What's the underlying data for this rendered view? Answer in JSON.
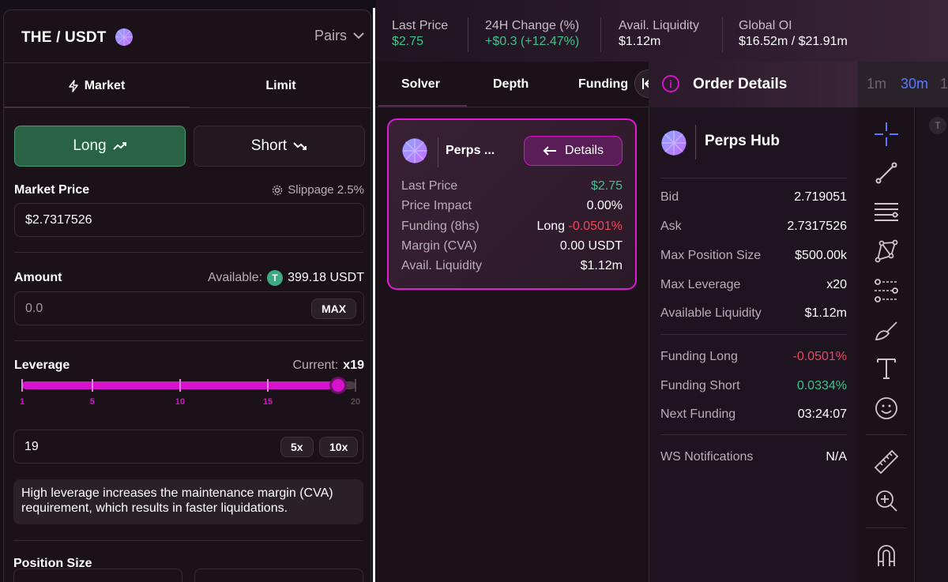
{
  "trade_panel": {
    "pair": "THE / USDT",
    "pairs_label": "Pairs",
    "tabs": {
      "market": "Market",
      "limit": "Limit"
    },
    "long_label": "Long",
    "short_label": "Short",
    "market_price_label": "Market Price",
    "slippage_label": "Slippage 2.5%",
    "market_price_value": "$2.7317526",
    "amount_label": "Amount",
    "available_label": "Available:",
    "available_token": "T",
    "available_amount": "399.18 USDT",
    "amount_placeholder": "0.0",
    "max_label": "MAX",
    "leverage_label": "Leverage",
    "current_label": "Current:",
    "current_value": "x19",
    "slider": {
      "value": 19,
      "min": 1,
      "max": 20,
      "ticks": [
        "1",
        "5",
        "10",
        "15",
        "20"
      ]
    },
    "leverage_input_value": "19",
    "presets": [
      "5x",
      "10x"
    ],
    "warning": "High leverage increases the maintenance margin (CVA) requirement, which results in faster liquidations.",
    "position_size_label": "Position Size"
  },
  "stats": [
    {
      "label": "Last Price",
      "value": "$2.75",
      "color": "green"
    },
    {
      "label": "24H Change (%)",
      "value": "+$0.3 (+12.47%)",
      "color": "green"
    },
    {
      "label": "Avail. Liquidity",
      "value": "$1.12m",
      "color": "white"
    },
    {
      "label": "Global OI",
      "value": "$16.52m / $21.91m",
      "color": "white"
    }
  ],
  "mid_tabs": [
    "Solver",
    "Depth",
    "Funding"
  ],
  "solver_card": {
    "name": "Perps ...",
    "details_label": "Details",
    "rows": [
      {
        "k": "Last Price",
        "v": "$2.75"
      },
      {
        "k": "Price Impact",
        "v": "0.00%"
      },
      {
        "k": "Funding (8hs)",
        "v_prefix": "Long",
        "v": "-0.0501%"
      },
      {
        "k": "Margin (CVA)",
        "v": "0.00 USDT"
      },
      {
        "k": "Avail. Liquidity",
        "v": "$1.12m"
      }
    ]
  },
  "order_details": {
    "title": "Order Details",
    "hub_name": "Perps Hub",
    "rows_a": [
      {
        "k": "Bid",
        "v": "2.719051"
      },
      {
        "k": "Ask",
        "v": "2.7317526"
      },
      {
        "k": "Max Position Size",
        "v": "$500.00k"
      },
      {
        "k": "Max Leverage",
        "v": "x20"
      },
      {
        "k": "Available Liquidity",
        "v": "$1.12m"
      }
    ],
    "rows_b": [
      {
        "k": "Funding Long",
        "v": "-0.0501%"
      },
      {
        "k": "Funding Short",
        "v": "0.0334%"
      },
      {
        "k": "Next Funding",
        "v": "03:24:07"
      }
    ],
    "rows_c": [
      {
        "k": "WS Notifications",
        "v": "N/A"
      }
    ]
  },
  "timeframes": [
    "1m",
    "30m",
    "1"
  ],
  "chart_marker": "T",
  "colors": {
    "accent": "#d613cc",
    "green": "#3ec18a",
    "red": "#f0455a",
    "long_bg": "#2a6246"
  }
}
